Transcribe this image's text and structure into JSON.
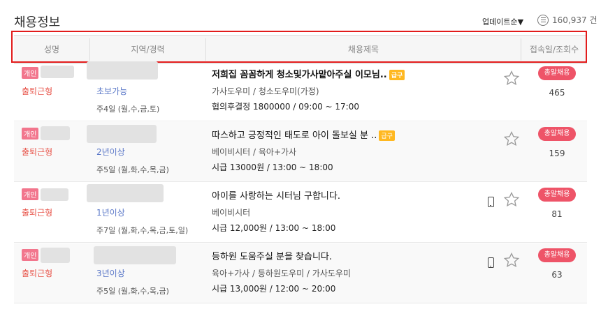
{
  "page": {
    "title": "채용정보",
    "sort_label": "업데이트순▼",
    "total_count": "160,937 건"
  },
  "columns": {
    "name": "성명",
    "region": "지역/경력",
    "job_title": "채용제목",
    "views": "접속일/조회수"
  },
  "rows": [
    {
      "badge": "개인",
      "work_type": "출퇴근형",
      "career": "초보가능",
      "days": "주4일 (월,수,금,토)",
      "title": "저희집 꼼꼼하게 청소및가사맡아주실 이모님..",
      "urgent": "급구",
      "category": "가사도우미 / 청소도우미(가정)",
      "pay": "협의후결정 1800000 / 09:00 ~ 17:00",
      "hire_badge": "총알채용",
      "views": "465",
      "phone": false
    },
    {
      "badge": "개인",
      "work_type": "출퇴근형",
      "career": "2년이상",
      "days": "주5일 (월,화,수,목,금)",
      "title": "따스하고 긍정적인 태도로 아이 돌보실 분 ..",
      "urgent": "급구",
      "category": "베이비시터 / 육아+가사",
      "pay": "시급 13000원 / 13:00 ~ 18:00",
      "hire_badge": "총알채용",
      "views": "159",
      "phone": false
    },
    {
      "badge": "개인",
      "work_type": "출퇴근형",
      "career": "1년이상",
      "days": "주7일 (월,화,수,목,금,토,일)",
      "title": "아이를 사랑하는 시터님 구합니다.",
      "urgent": "",
      "category": "베이비시터",
      "pay": "시급 12,000원 / 13:00 ~ 18:00",
      "hire_badge": "총알채용",
      "views": "81",
      "phone": true
    },
    {
      "badge": "개인",
      "work_type": "출퇴근형",
      "career": "3년이상",
      "days": "주5일 (월,화,수,목,금)",
      "title": "등하원 도움주실 분을 찾습니다.",
      "urgent": "",
      "category": "육아+가사 / 등하원도우미 / 가사도우미",
      "pay": "시급 13,000원 / 12:00 ~ 20:00",
      "hire_badge": "총알채용",
      "views": "63",
      "phone": true
    }
  ],
  "colors": {
    "highlight_border": "#e21b1b",
    "hire_badge": "#ee5468",
    "urgent_badge": "#ffb820",
    "individual_badge": "#f2768d"
  },
  "icons": {
    "favorite": "star-icon",
    "phone": "phone-icon",
    "list": "list-icon"
  }
}
